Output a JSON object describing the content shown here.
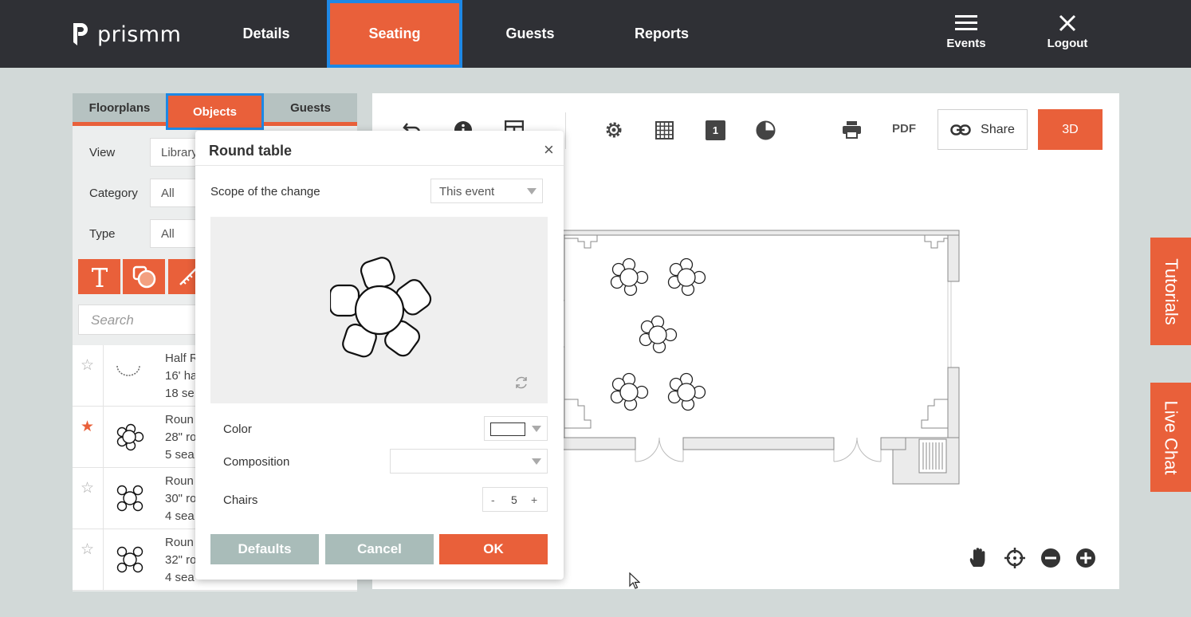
{
  "brand": {
    "name": "prismm",
    "accent": "#e9603a",
    "topbar": "#2f3035",
    "focus": "#1e88e5"
  },
  "nav": {
    "items": [
      {
        "label": "Details"
      },
      {
        "label": "Seating"
      },
      {
        "label": "Guests"
      },
      {
        "label": "Reports"
      }
    ],
    "active": "Seating",
    "events_label": "Events",
    "logout_label": "Logout"
  },
  "left_panel": {
    "tabs": [
      {
        "label": "Floorplans"
      },
      {
        "label": "Objects"
      },
      {
        "label": "Guests"
      }
    ],
    "active_tab": "Objects",
    "filters": [
      {
        "label": "View",
        "value": "Library"
      },
      {
        "label": "Category",
        "value": "All"
      },
      {
        "label": "Type",
        "value": "All"
      }
    ],
    "tools": [
      "text-tool-icon",
      "shape-tool-icon",
      "measure-tool-icon"
    ],
    "search_placeholder": "Search",
    "items": [
      {
        "line1": "Half R",
        "line2": "16' ha",
        "line3": "18 se",
        "starred": false
      },
      {
        "line1": "Roun",
        "line2": "28\" ro",
        "line3": "5 sea",
        "starred": true
      },
      {
        "line1": "Roun",
        "line2": "30\" ro",
        "line3": "4 sea",
        "starred": false
      },
      {
        "line1": "Roun",
        "line2": "32\" ro",
        "line3": "4 sea",
        "starred": false
      }
    ]
  },
  "toolbar": {
    "icons": [
      "undo-icon",
      "info-icon",
      "layout-icon",
      "settings-icon",
      "grid-icon",
      "level-icon",
      "pie-icon",
      "print-icon"
    ],
    "level_badge": "1",
    "pdf_label": "PDF",
    "share_label": "Share",
    "btn_3d_label": "3D",
    "zoom_icons": [
      "hand-icon",
      "crosshair-icon",
      "zoom-out-icon",
      "zoom-in-icon"
    ]
  },
  "side_tabs": {
    "tutorials": "Tutorials",
    "live_chat": "Live Chat"
  },
  "modal": {
    "title": "Round table",
    "close_glyph": "×",
    "scope_label": "Scope of the change",
    "scope_value": "This event",
    "color_label": "Color",
    "color_value": "#ffffff",
    "composition_label": "Composition",
    "composition_value": "",
    "chairs_label": "Chairs",
    "chairs_value": "5",
    "minus": "-",
    "plus": "+",
    "defaults_label": "Defaults",
    "cancel_label": "Cancel",
    "ok_label": "OK"
  }
}
